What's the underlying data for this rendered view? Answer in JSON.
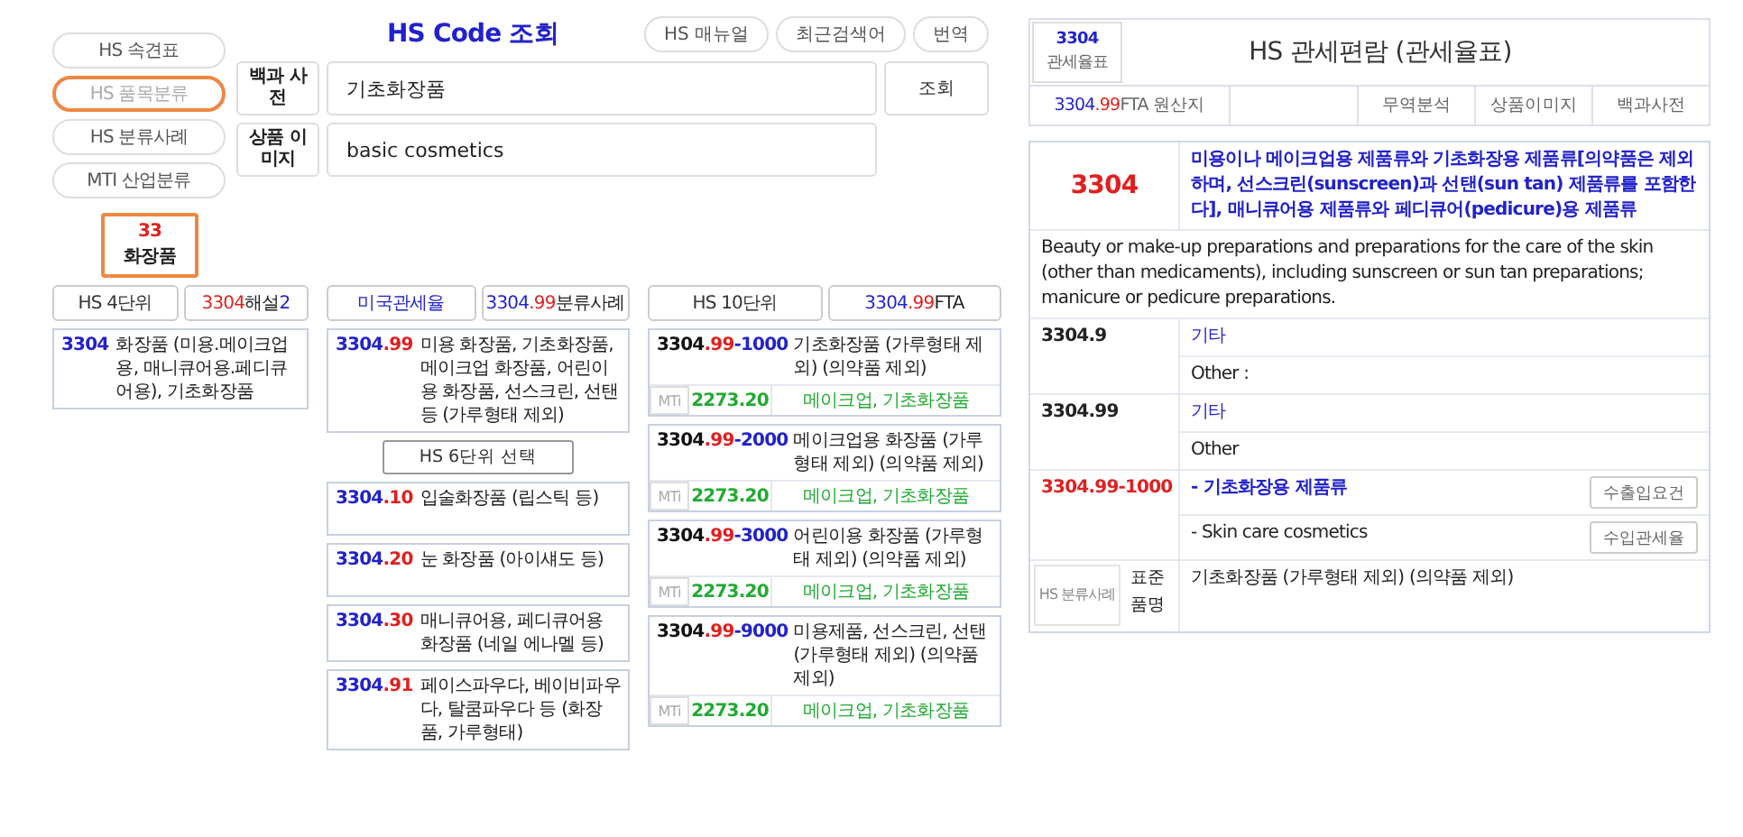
{
  "header": {
    "title": "HS Code 조회",
    "buttons": [
      "HS 매뉴얼",
      "최근검색어",
      "번역"
    ]
  },
  "nav": [
    {
      "label": "HS 속견표",
      "selected": false
    },
    {
      "label": "HS 품목분류",
      "selected": true
    },
    {
      "label": "HS 분류사례",
      "selected": false
    },
    {
      "label": "MTI 산업분류",
      "selected": false
    }
  ],
  "chapter": {
    "code": "33",
    "name": "화장품"
  },
  "search_rows": [
    {
      "label": "백과 사전",
      "value": "기초화장품"
    },
    {
      "label": "상품 이미지",
      "value": "basic cosmetics"
    }
  ],
  "search_button": "조회",
  "hs4": {
    "tabs": [
      [
        {
          "text": "HS 4단위",
          "color": "#333333"
        }
      ],
      [
        {
          "text": "3304",
          "color": "#e02020"
        },
        {
          "text": " 해설 ",
          "color": "#222222"
        },
        {
          "text": "2",
          "color": "#2222cc"
        }
      ]
    ],
    "items": [
      {
        "code": [
          {
            "text": "3304",
            "color": "#2222cc"
          }
        ],
        "desc": "화장품 (미용.메이크업용, 매니큐어용.페디큐어용), 기초화장품"
      }
    ]
  },
  "hs6": {
    "tabs": [
      [
        {
          "text": "미국관세율",
          "color": "#2222cc"
        }
      ],
      [
        {
          "text": "3304",
          "color": "#2222cc"
        },
        {
          "text": ".99",
          "color": "#e02020"
        },
        {
          "text": " 분류사례",
          "color": "#222222"
        }
      ]
    ],
    "current": {
      "code": [
        {
          "text": "3304",
          "color": "#2222cc"
        },
        {
          "text": ".99",
          "color": "#e02020"
        }
      ],
      "desc": "미용 화장품, 기초화장품, 메이크업 화장품, 어린이용 화장품, 선스크린, 선탠 등 (가루형태 제외)"
    },
    "select_button": "HS 6단위 선택",
    "items": [
      {
        "code": [
          {
            "text": "3304",
            "color": "#2222cc"
          },
          {
            "text": ".10",
            "color": "#e02020"
          }
        ],
        "desc": "입술화장품 (립스틱 등)"
      },
      {
        "code": [
          {
            "text": "3304",
            "color": "#2222cc"
          },
          {
            "text": ".20",
            "color": "#e02020"
          }
        ],
        "desc": "눈 화장품 (아이섀도 등)"
      },
      {
        "code": [
          {
            "text": "3304",
            "color": "#2222cc"
          },
          {
            "text": ".30",
            "color": "#e02020"
          }
        ],
        "desc": "매니큐어용, 페디큐어용 화장품 (네일 에나멜 등)"
      },
      {
        "code": [
          {
            "text": "3304",
            "color": "#2222cc"
          },
          {
            "text": ".91",
            "color": "#e02020"
          }
        ],
        "desc": "페이스파우다, 베이비파우다, 탈쿰파우다 등 (화장품, 가루형태)"
      }
    ]
  },
  "hs10": {
    "tabs": [
      [
        {
          "text": "HS 10단위",
          "color": "#333333"
        }
      ],
      [
        {
          "text": "3304",
          "color": "#2222cc"
        },
        {
          "text": ".99",
          "color": "#e02020"
        },
        {
          "text": " FTA",
          "color": "#222222"
        }
      ]
    ],
    "items": [
      {
        "code": [
          {
            "text": "3304",
            "color": "#111111"
          },
          {
            "text": ".99",
            "color": "#e02020"
          },
          {
            "text": "-1000",
            "color": "#2222cc"
          }
        ],
        "desc": "기초화장품 (가루형태 제외) (의약품 제외)",
        "mti": "MTi",
        "value": "2273.20",
        "category": "메이크업, 기초화장품"
      },
      {
        "code": [
          {
            "text": "3304",
            "color": "#111111"
          },
          {
            "text": ".99",
            "color": "#e02020"
          },
          {
            "text": "-2000",
            "color": "#2222cc"
          }
        ],
        "desc": "메이크업용 화장품 (가루형태 제외) (의약품 제외)",
        "mti": "MTi",
        "value": "2273.20",
        "category": "메이크업, 기초화장품"
      },
      {
        "code": [
          {
            "text": "3304",
            "color": "#111111"
          },
          {
            "text": ".99",
            "color": "#e02020"
          },
          {
            "text": "-3000",
            "color": "#2222cc"
          }
        ],
        "desc": "어린이용 화장품 (가루형태 제외) (의약품 제외)",
        "mti": "MTi",
        "value": "2273.20",
        "category": "메이크업, 기초화장품"
      },
      {
        "code": [
          {
            "text": "3304",
            "color": "#111111"
          },
          {
            "text": ".99",
            "color": "#e02020"
          },
          {
            "text": "-9000",
            "color": "#2222cc"
          }
        ],
        "desc": "미용제품, 선스크린, 선탠 (가루형태 제외) (의약품 제외)",
        "mti": "MTi",
        "value": "2273.20",
        "category": "메이크업, 기초화장품"
      }
    ]
  },
  "tariff": {
    "code": "3304",
    "code_label": "관세율표",
    "title": "HS 관세편람 (관세율표)",
    "fta_tab": [
      {
        "text": "3304",
        "color": "#2222cc"
      },
      {
        "text": ".99",
        "color": "#e02020"
      },
      {
        "text": " FTA 원산지",
        "color": "#666666"
      }
    ],
    "tabs": [
      "무역분석",
      "상품이미지",
      "백과사전"
    ],
    "heading": {
      "code": "3304",
      "korean": "미용이나 메이크업용 제품류와 기초화장용 제품류[의약품은 제외하며, 선스크린(sunscreen)과 선탠(sun tan) 제품류를 포함한다], 매니큐어용 제품류와 페디큐어(pedicure)용 제품류",
      "english": "Beauty or make-up preparations and preparations for the care of the skin (other than medicaments), including sunscreen or sun tan preparations; manicure or pedicure preparations."
    },
    "subheadings": [
      {
        "code": "3304.9",
        "selected": false,
        "korean": "기타",
        "english": "Other :"
      },
      {
        "code": "3304.99",
        "selected": false,
        "korean": "기타",
        "english": "Other"
      },
      {
        "code": "3304.99-1000",
        "selected": true,
        "korean": "- 기초화장용 제품류",
        "english": "- Skin care cosmetics",
        "buttons": [
          "수출입요건",
          "수입관세율"
        ]
      }
    ],
    "footer": {
      "button": "HS 분류사례",
      "label": "표준품명",
      "text": "기초화장품 (가루형태 제외) (의약품 제외)"
    }
  }
}
